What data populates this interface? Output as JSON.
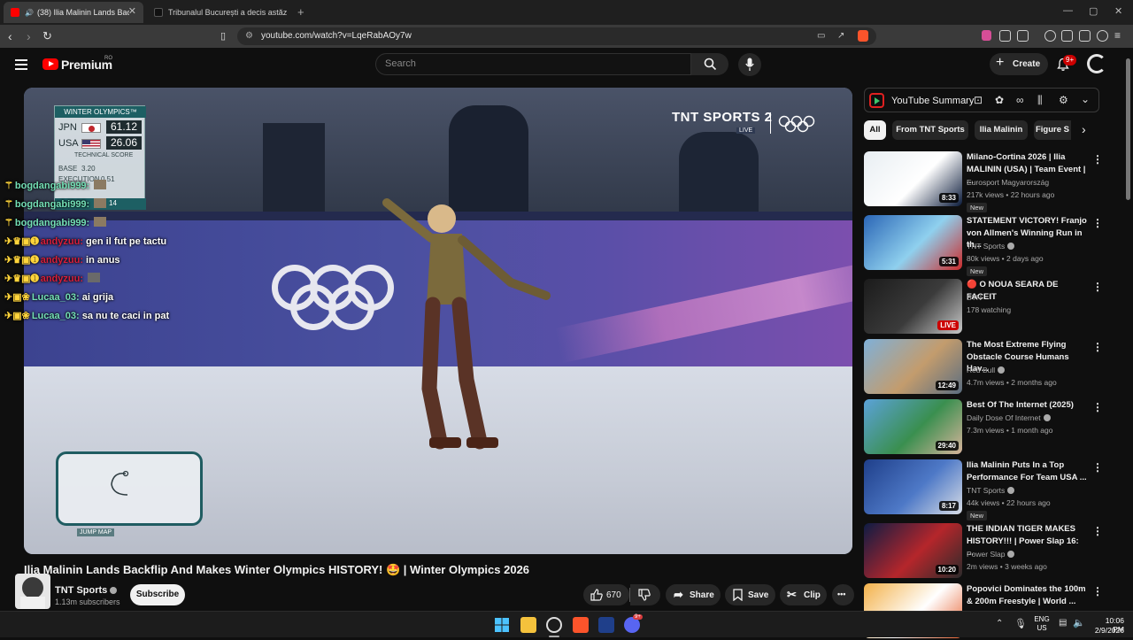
{
  "browser": {
    "tabs": [
      {
        "label": "(38) Ilia Malinin Lands Backflip",
        "active": true
      },
      {
        "label": "Tribunalul București a decis astăzi ci",
        "active": false
      }
    ],
    "new_tab": "+",
    "url": "youtube.com/watch?v=LqeRabAOy7w"
  },
  "header": {
    "logo": "Premium",
    "region": "RO",
    "search_placeholder": "Search",
    "create_label": "Create",
    "notifications": "9+"
  },
  "player": {
    "scoreboard": {
      "title": "WINTER OLYMPICS™",
      "rows": [
        {
          "country": "JPN",
          "score": "61.12"
        },
        {
          "country": "USA",
          "score": "26.06"
        }
      ],
      "technical": "TECHNICAL SCORE",
      "base_label": "BASE",
      "base_value": "3.20",
      "execution_label": "EXECUTION",
      "execution_value": "0.51",
      "extra": "14"
    },
    "broadcaster": "TNT SPORTS 2",
    "live_tag": "LIVE",
    "jump_map": "JUMP MAP"
  },
  "chat": [
    {
      "user": "bogdangabi999:",
      "msg": "",
      "style": "green"
    },
    {
      "user": "bogdangabi999:",
      "msg": "",
      "style": "green"
    },
    {
      "user": "bogdangabi999:",
      "msg": "",
      "style": "green"
    },
    {
      "user": "andyzuu:",
      "msg": "gen il fut pe tactu",
      "style": "red"
    },
    {
      "user": "andyzuu:",
      "msg": "in anus",
      "style": "red"
    },
    {
      "user": "andyzuu:",
      "msg": "",
      "style": "red"
    },
    {
      "user": "Lucaa_03:",
      "msg": "ai grija",
      "style": "green"
    },
    {
      "user": "Lucaa_03:",
      "msg": "sa nu te caci in pat",
      "style": "green"
    }
  ],
  "video": {
    "title": "Ilia Malinin Lands Backflip And Makes Winter Olympics HISTORY! 🤩 | Winter Olympics 2026",
    "channel": "TNT Sports",
    "subscribers": "1.13m subscribers",
    "subscribe_label": "Subscribe",
    "likes": "670",
    "share_label": "Share",
    "save_label": "Save",
    "clip_label": "Clip",
    "more": "•••"
  },
  "sidebar": {
    "extension_title": "YouTube Summary",
    "chips": [
      "All",
      "From TNT Sports",
      "Ilia Malinin",
      "Figure S"
    ],
    "recommendations": [
      {
        "title": "Milano-Cortina 2026 | Ilia MALININ (USA) | Team Event | ...",
        "channel": "Eurosport Magyarország",
        "meta": "217k views • 22 hours ago",
        "badge": "New",
        "duration": "8:33",
        "verified": false,
        "live": false,
        "thumb_colors": [
          "#e8eef2",
          "#ffffff",
          "#0a1a3a"
        ]
      },
      {
        "title": "STATEMENT VICTORY! Franjo von Allmen's Winning Run in th...",
        "channel": "TNT Sports",
        "meta": "80k views • 2 days ago",
        "badge": "New",
        "duration": "5:31",
        "verified": true,
        "live": false,
        "thumb_colors": [
          "#2b66b6",
          "#8fd0ee",
          "#cc2b2b"
        ]
      },
      {
        "title": "🔴 O NOUA SEARA DE FACEIT",
        "channel": "BTN",
        "meta": "178 watching",
        "badge": "",
        "duration": "LIVE",
        "verified": false,
        "live": true,
        "thumb_colors": [
          "#1b1b1b",
          "#3b3b3b",
          "#c9c9c9"
        ]
      },
      {
        "title": "The Most Extreme Flying Obstacle Course Humans Hav...",
        "channel": "Red Bull",
        "meta": "4.7m views • 2 months ago",
        "badge": "",
        "duration": "12:49",
        "verified": true,
        "live": false,
        "thumb_colors": [
          "#7fb0d8",
          "#c39c6d",
          "#5a6d80"
        ]
      },
      {
        "title": "Best Of The Internet (2025)",
        "channel": "Daily Dose Of Internet",
        "meta": "7.3m views • 1 month ago",
        "badge": "",
        "duration": "29:40",
        "verified": true,
        "live": false,
        "thumb_colors": [
          "#5ba2d9",
          "#3a8f4f",
          "#d7b49b"
        ]
      },
      {
        "title": "Ilia Malinin Puts In a Top Performance For Team USA ...",
        "channel": "TNT Sports",
        "meta": "44k views • 22 hours ago",
        "badge": "New",
        "duration": "8:17",
        "verified": true,
        "live": false,
        "thumb_colors": [
          "#1f3f8a",
          "#4e79c7",
          "#d8dde6"
        ]
      },
      {
        "title": "THE INDIAN TIGER MAKES HISTORY!!! | Power Slap 16: ...",
        "channel": "Power Slap",
        "meta": "2m views • 3 weeks ago",
        "badge": "",
        "duration": "10:20",
        "verified": true,
        "live": false,
        "thumb_colors": [
          "#0e1c44",
          "#b5262b",
          "#2b2b2b"
        ]
      },
      {
        "title": "Popovici Dominates the 100m & 200m Freestyle | World ...",
        "channel": "",
        "meta": "",
        "badge": "",
        "duration": "",
        "verified": false,
        "live": false,
        "thumb_colors": [
          "#f3b14a",
          "#ffffff",
          "#e65c2a"
        ]
      }
    ]
  },
  "taskbar": {
    "lang": "ENG",
    "region": "US",
    "time": "10:06 PM",
    "date": "2/9/2026",
    "discord_badge": "9+"
  }
}
